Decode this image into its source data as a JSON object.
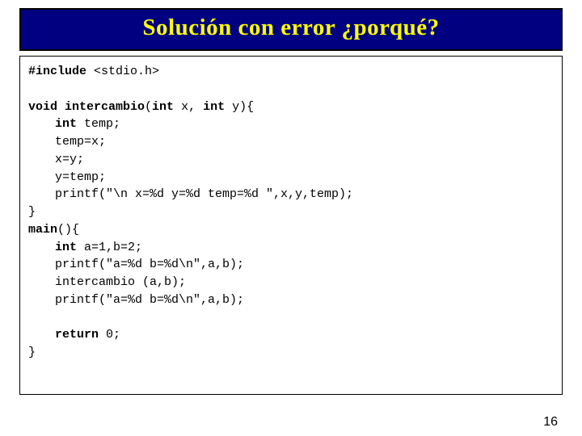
{
  "title": "Solución con error ¿porqué?",
  "code": {
    "l01a": "#include",
    "l01b": " <stdio.h>",
    "l03a": "void intercambio",
    "l03b": "(",
    "l03c": "int",
    "l03d": " x, ",
    "l03e": "int",
    "l03f": " y){",
    "l04a": "int",
    "l04b": " temp;",
    "l05": "temp=x;",
    "l06": "x=y;",
    "l07": "y=temp;",
    "l08": "printf(\"\\n x=%d y=%d temp=%d \",x,y,temp);",
    "l09": "}",
    "l10a": "main",
    "l10b": "(){",
    "l11a": "int",
    "l11b": " a=1,b=2;",
    "l12": "printf(\"a=%d b=%d\\n\",a,b);",
    "l13": "intercambio (a,b);",
    "l14": "printf(\"a=%d b=%d\\n\",a,b);",
    "l16a": "return",
    "l16b": " 0;",
    "l17": "}"
  },
  "pageNumber": "16"
}
